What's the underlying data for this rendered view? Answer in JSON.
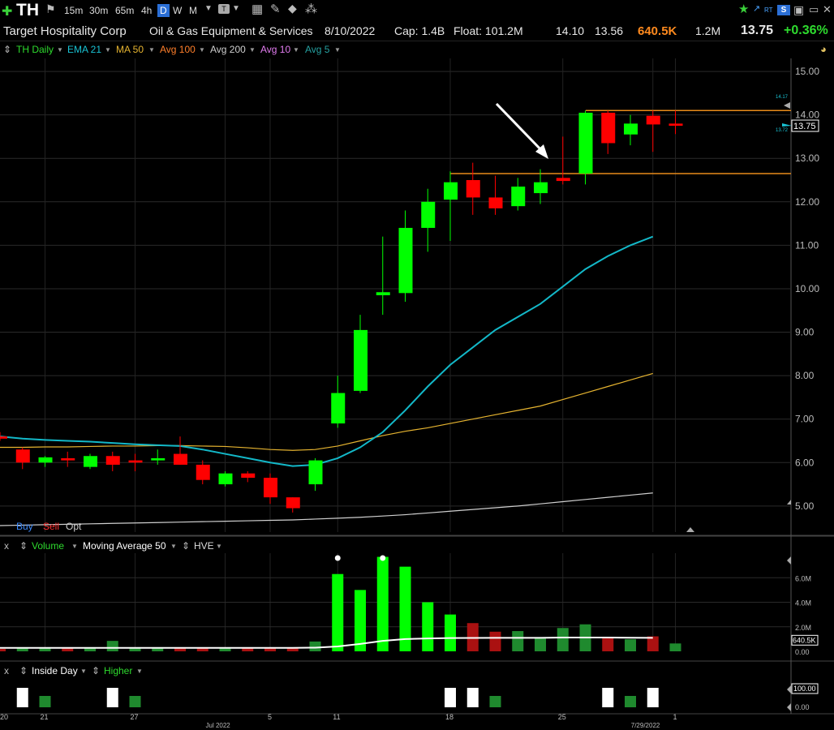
{
  "toolbar": {
    "plus": "✚",
    "ticker": "TH",
    "timeframes": [
      "15m",
      "30m",
      "65m",
      "4h",
      "D",
      "W",
      "M"
    ],
    "active_timeframe": "D",
    "rt": "RT"
  },
  "info": {
    "company": "Target Hospitality Corp",
    "industry": "Oil & Gas Equipment & Services",
    "date": "8/10/2022",
    "cap": "Cap: 1.4B",
    "float": "Float: 101.2M",
    "high": "14.10",
    "low": "13.56",
    "volume": "640.5K",
    "avg_volume": "1.2M",
    "last": "13.75",
    "change": "+0.36%"
  },
  "studies": {
    "daily": "TH Daily",
    "ema21": "EMA 21",
    "ma50": "MA 50",
    "avg100": "Avg 100",
    "avg200": "Avg 200",
    "avg10": "Avg 10",
    "avg5": "Avg 5"
  },
  "trade": {
    "buy": "Buy",
    "sell": "Sell",
    "opt": "Opt"
  },
  "volume_header": {
    "close": "x",
    "volume": "Volume",
    "ma": "Moving Average 50",
    "hve": "HVE"
  },
  "inside_header": {
    "close": "x",
    "inside": "Inside Day",
    "higher": "Higher"
  },
  "colors": {
    "up": "#00ff00",
    "down": "#ff0000",
    "ema": "#13b8c8",
    "ma50": "#e6b430",
    "avg200": "#cfcfcf",
    "level": "#e88a1a"
  },
  "chart_data": [
    {
      "type": "candlestick",
      "ylim": [
        4.4,
        15.3
      ],
      "yticks": [
        "5.00",
        "6.00",
        "7.00",
        "8.00",
        "9.00",
        "10.00",
        "11.00",
        "12.00",
        "13.00",
        "14.00",
        "15.00"
      ],
      "xticks": [
        {
          "label": "20",
          "i": -1
        },
        {
          "label": "21",
          "i": 2
        },
        {
          "label": "27",
          "i": 6
        },
        {
          "label": "Jul 2022",
          "i": 10
        },
        {
          "label": "5",
          "i": 12
        },
        {
          "label": "11",
          "i": 15
        },
        {
          "label": "18",
          "i": 20
        },
        {
          "label": "25",
          "i": 25
        },
        {
          "label": "7/29/2022",
          "i": 29
        },
        {
          "label": "1",
          "i": 30
        }
      ],
      "candles": [
        {
          "o": 6.6,
          "h": 6.7,
          "l": 6.5,
          "c": 6.55
        },
        {
          "o": 6.3,
          "h": 6.35,
          "l": 5.85,
          "c": 6.0
        },
        {
          "o": 6.0,
          "h": 6.15,
          "l": 5.9,
          "c": 6.12
        },
        {
          "o": 6.1,
          "h": 6.25,
          "l": 5.9,
          "c": 6.05
        },
        {
          "o": 5.9,
          "h": 6.2,
          "l": 5.85,
          "c": 6.15
        },
        {
          "o": 6.15,
          "h": 6.25,
          "l": 5.8,
          "c": 5.95
        },
        {
          "o": 6.05,
          "h": 6.2,
          "l": 5.8,
          "c": 6.0
        },
        {
          "o": 6.05,
          "h": 6.3,
          "l": 5.95,
          "c": 6.1
        },
        {
          "o": 6.2,
          "h": 6.6,
          "l": 5.95,
          "c": 5.95
        },
        {
          "o": 5.95,
          "h": 6.05,
          "l": 5.5,
          "c": 5.6
        },
        {
          "o": 5.5,
          "h": 5.8,
          "l": 5.45,
          "c": 5.75
        },
        {
          "o": 5.75,
          "h": 5.8,
          "l": 5.55,
          "c": 5.65
        },
        {
          "o": 5.65,
          "h": 5.75,
          "l": 5.05,
          "c": 5.2
        },
        {
          "o": 5.2,
          "h": 5.2,
          "l": 4.85,
          "c": 4.95
        },
        {
          "o": 5.5,
          "h": 6.1,
          "l": 5.35,
          "c": 6.05
        },
        {
          "o": 6.9,
          "h": 8.0,
          "l": 6.8,
          "c": 7.6
        },
        {
          "o": 7.65,
          "h": 9.4,
          "l": 7.6,
          "c": 9.05
        },
        {
          "o": 9.85,
          "h": 11.2,
          "l": 9.4,
          "c": 9.92
        },
        {
          "o": 9.9,
          "h": 11.8,
          "l": 9.7,
          "c": 11.4
        },
        {
          "o": 11.4,
          "h": 12.3,
          "l": 10.85,
          "c": 12.0
        },
        {
          "o": 12.05,
          "h": 12.7,
          "l": 11.1,
          "c": 12.45
        },
        {
          "o": 12.5,
          "h": 12.9,
          "l": 11.7,
          "c": 12.1
        },
        {
          "o": 12.1,
          "h": 12.6,
          "l": 11.7,
          "c": 11.85
        },
        {
          "o": 11.9,
          "h": 12.55,
          "l": 11.8,
          "c": 12.35
        },
        {
          "o": 12.2,
          "h": 12.75,
          "l": 11.95,
          "c": 12.45
        },
        {
          "o": 12.55,
          "h": 13.5,
          "l": 12.4,
          "c": 12.48
        },
        {
          "o": 12.65,
          "h": 14.1,
          "l": 12.4,
          "c": 14.05
        },
        {
          "o": 14.05,
          "h": 14.1,
          "l": 13.1,
          "c": 13.35
        },
        {
          "o": 13.55,
          "h": 14.0,
          "l": 13.3,
          "c": 13.8
        },
        {
          "o": 13.98,
          "h": 14.1,
          "l": 13.15,
          "c": 13.78
        },
        {
          "o": 13.8,
          "h": 14.1,
          "l": 13.56,
          "c": 13.75
        }
      ],
      "ema21": [
        6.6,
        6.55,
        6.52,
        6.5,
        6.48,
        6.45,
        6.42,
        6.4,
        6.38,
        6.3,
        6.2,
        6.1,
        6.0,
        5.92,
        5.95,
        6.1,
        6.35,
        6.7,
        7.2,
        7.75,
        8.25,
        8.65,
        9.05,
        9.35,
        9.65,
        10.05,
        10.45,
        10.75,
        11.0,
        11.2
      ],
      "ma50": [
        6.35,
        6.35,
        6.36,
        6.36,
        6.37,
        6.38,
        6.38,
        6.39,
        6.39,
        6.38,
        6.37,
        6.34,
        6.3,
        6.28,
        6.3,
        6.38,
        6.5,
        6.62,
        6.72,
        6.8,
        6.9,
        7.0,
        7.1,
        7.2,
        7.3,
        7.45,
        7.6,
        7.75,
        7.9,
        8.05
      ],
      "avg200": [
        4.55,
        4.56,
        4.57,
        4.58,
        4.59,
        4.6,
        4.61,
        4.62,
        4.63,
        4.64,
        4.65,
        4.66,
        4.67,
        4.68,
        4.7,
        4.72,
        4.74,
        4.77,
        4.8,
        4.84,
        4.88,
        4.92,
        4.96,
        5.0,
        5.05,
        5.1,
        5.15,
        5.2,
        5.25,
        5.3
      ],
      "levels": [
        12.65,
        14.1
      ],
      "last_price": "13.75",
      "ref_high": "14.17",
      "ref_low": "13.72"
    },
    {
      "type": "bar",
      "title": "Volume",
      "ylim": [
        0,
        8000000
      ],
      "yticks": [
        "0.00",
        "2.0M",
        "4.0M",
        "6.0M"
      ],
      "values": [
        200000,
        300000,
        250000,
        300000,
        280000,
        850000,
        300000,
        250000,
        300000,
        320000,
        250000,
        320000,
        300000,
        300000,
        800000,
        6300000,
        5000000,
        7700000,
        6900000,
        4000000,
        3000000,
        2300000,
        1600000,
        1650000,
        1150000,
        1900000,
        2200000,
        1100000,
        980000,
        1220000,
        640500
      ],
      "up": [
        0,
        1,
        1,
        0,
        1,
        1,
        1,
        1,
        0,
        0,
        1,
        0,
        0,
        0,
        1,
        1,
        1,
        1,
        1,
        1,
        1,
        0,
        0,
        1,
        1,
        1,
        1,
        0,
        1,
        0,
        1
      ],
      "ma": [
        280000,
        280000,
        280000,
        280000,
        280000,
        280000,
        280000,
        280000,
        280000,
        280000,
        280000,
        280000,
        280000,
        280000,
        300000,
        400000,
        600000,
        850000,
        1000000,
        1050000,
        1080000,
        1090000,
        1100000,
        1100000,
        1100000,
        1120000,
        1120000,
        1120000,
        1110000,
        1100000
      ],
      "hve": [
        15,
        17
      ],
      "last": "640.5K"
    },
    {
      "type": "bar",
      "title": "Inside Day",
      "yticks": [
        "0.00",
        "100.00"
      ],
      "inside": [
        1,
        5,
        20,
        21,
        27,
        29
      ],
      "higher": [
        2,
        6,
        22,
        28
      ]
    }
  ]
}
